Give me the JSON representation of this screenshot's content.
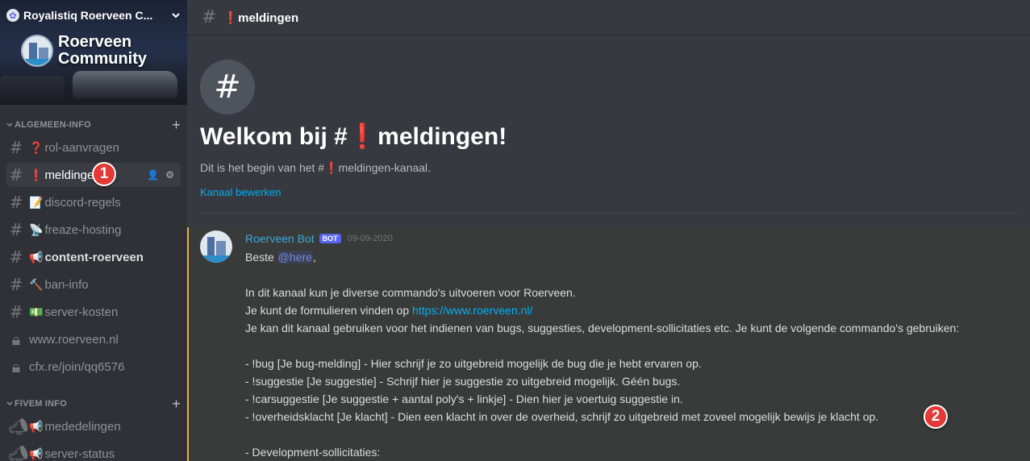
{
  "server": {
    "name": "Royalistiq Roerveen C...",
    "badge_icon": "flower-icon",
    "logo_line1": "Roerveen",
    "logo_line2": "Community"
  },
  "categories": [
    {
      "label": "ALGEMEEN-INFO",
      "add": "+"
    },
    {
      "label": "FIVEM INFO",
      "add": "+"
    }
  ],
  "channels": [
    {
      "icon": "hashtag-icon",
      "emoji": "❓",
      "label": "rol-aanvragen"
    },
    {
      "icon": "hashtag-icon",
      "emoji": "❗",
      "label": "meldingen"
    },
    {
      "icon": "hashtag-icon",
      "emoji": "📝",
      "label": "discord-regels"
    },
    {
      "icon": "hashtag-icon",
      "emoji": "📡",
      "label": "freaze-hosting"
    },
    {
      "icon": "hashtag-icon",
      "emoji": "📢",
      "label": "content-roerveen"
    },
    {
      "icon": "hashtag-icon",
      "emoji": "🔨",
      "label": "ban-info"
    },
    {
      "icon": "hashtag-icon",
      "emoji": "💵",
      "label": "server-kosten"
    },
    {
      "icon": "lock-icon",
      "emoji": "",
      "label": "www.roerveen.nl"
    },
    {
      "icon": "lock-icon",
      "emoji": "",
      "label": "cfx.re/join/qq6576"
    },
    {
      "icon": "megaphone-icon",
      "emoji": "📢",
      "label": "mededelingen"
    },
    {
      "icon": "megaphone-icon",
      "emoji": "📢",
      "label": "server-status"
    }
  ],
  "annotations": {
    "one": "1",
    "two": "2"
  },
  "topbar": {
    "channel": "❗meldingen"
  },
  "welcome": {
    "title": "Welkom bij #❗meldingen!",
    "subtitle": "Dit is het begin van het #❗meldingen-kanaal.",
    "edit_link": "Kanaal bewerken"
  },
  "message": {
    "author": "Roerveen Bot",
    "tag": "BOT",
    "timestamp": "09-09-2020",
    "greeting": "Beste ",
    "mention": "@here",
    "greeting_end": ",",
    "l1": "In dit kanaal kun je diverse commando's uitvoeren voor Roerveen.",
    "l2_prefix": "Je kunt de formulieren vinden op ",
    "l2_link": "https://www.roerveen.nl/",
    "l3": "Je kan dit kanaal gebruiken voor het indienen van bugs, suggesties, development-sollicitaties etc. Je kunt de volgende commando's gebruiken:",
    "l4": "- !bug [Je bug-melding] - Hier schrijf je zo uitgebreid mogelijk de bug die je hebt ervaren op.",
    "l5": "- !suggestie [Je suggestie] - Schrijf hier je suggestie zo uitgebreid mogelijk. Géén bugs.",
    "l6": "- !carsuggestie [Je suggestie + aantal poly's + linkje] - Dien hier je voertuig suggestie in.",
    "l7": "- !overheidsklacht [Je klacht] - Dien een klacht in over de overheid, schrijf zo uitgebreid met zoveel mogelijk bewijs je klacht op.",
    "l8": "- Development-sollicitaties:"
  },
  "colors": {
    "accent": "#5865f2",
    "link": "#00b0f4",
    "highlight_border": "#f0b232",
    "badge_red": "#e53935"
  }
}
